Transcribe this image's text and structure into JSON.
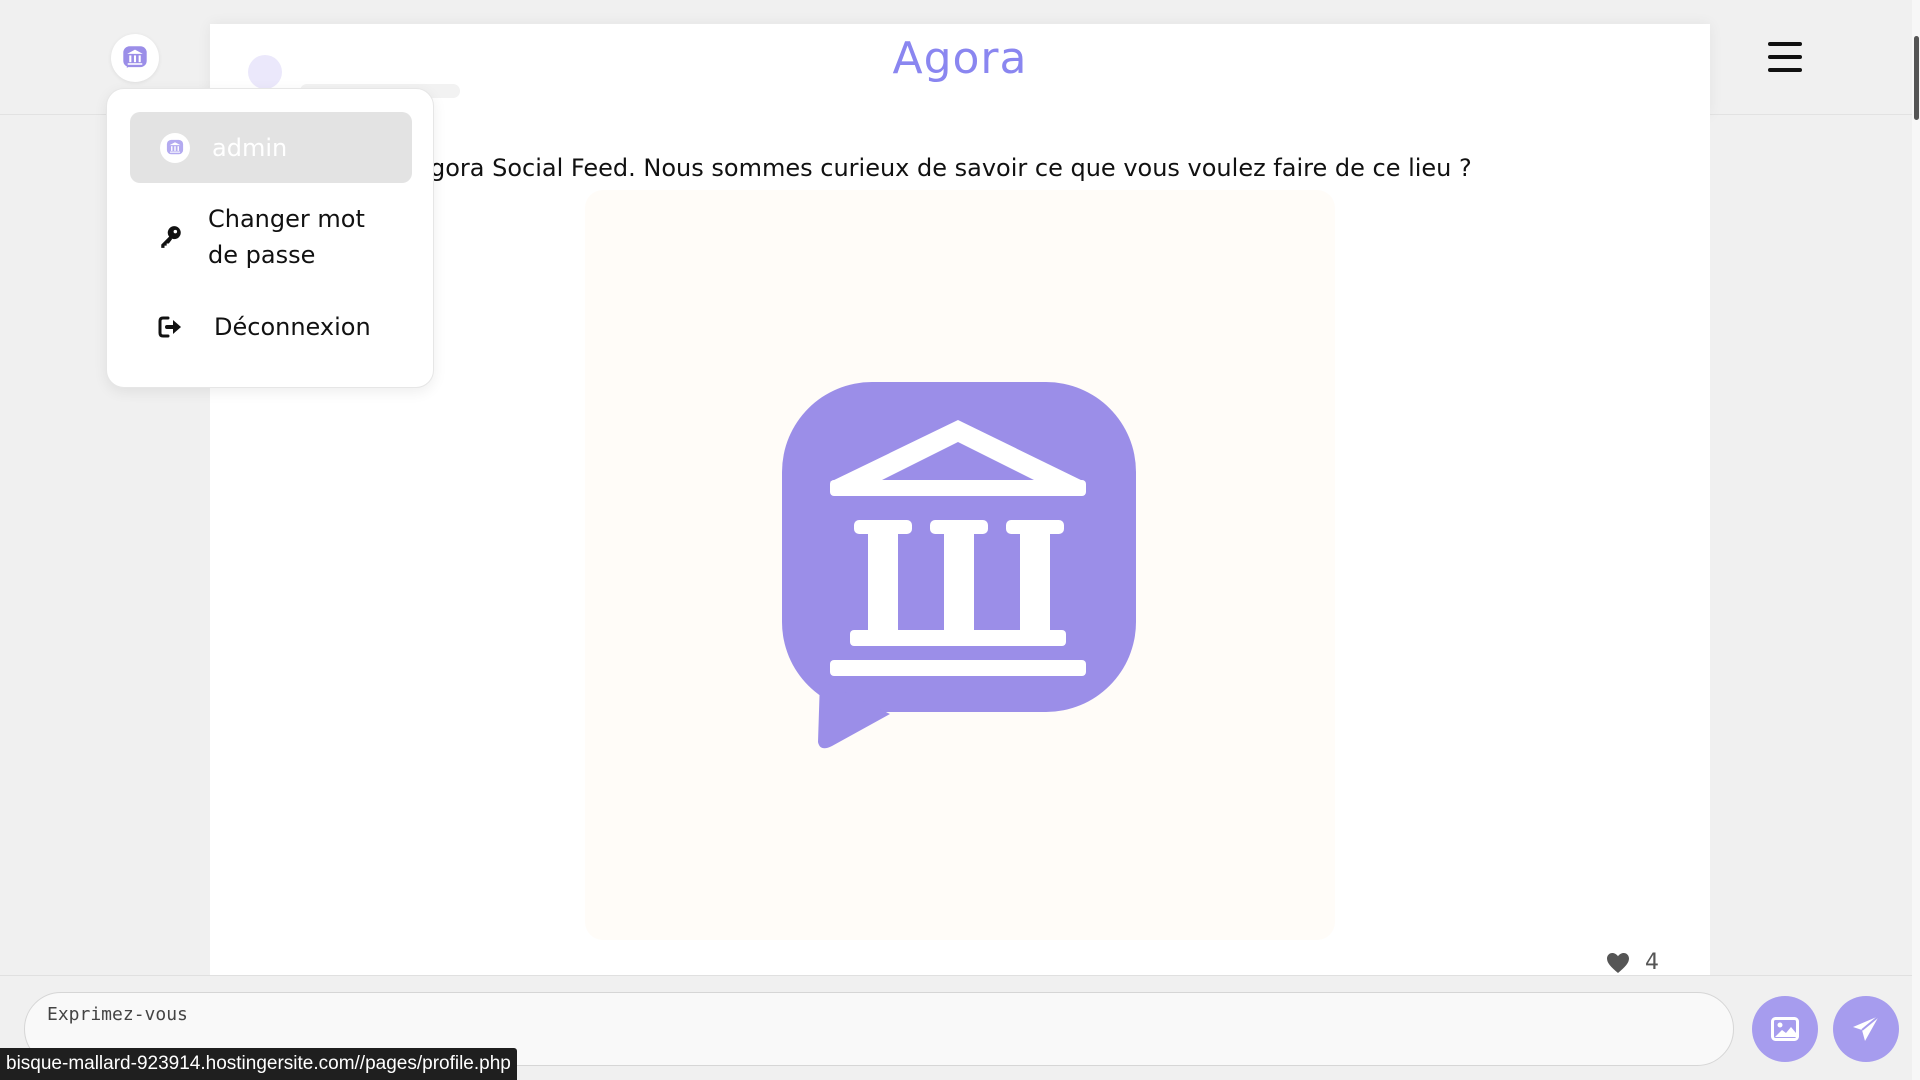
{
  "header": {
    "title": "Agora",
    "avatar_icon": "agora-logo-icon",
    "menu_icon": "hamburger-icon"
  },
  "post": {
    "text": "gora Social Feed. Nous sommes curieux de savoir ce que vous voulez faire de ce lieu ?",
    "image_icon": "agora-building-chat-icon",
    "likes": "4"
  },
  "menu": {
    "user_label": "admin",
    "items": [
      {
        "label": "Changer mot de passe",
        "icon": "key-icon"
      },
      {
        "label": "Déconnexion",
        "icon": "logout-icon"
      }
    ]
  },
  "composer": {
    "placeholder": "Exprimez-vous",
    "image_button_icon": "image-icon",
    "send_button_icon": "send-icon"
  },
  "status_url": "bisque-mallard-923914.hostingersite.com//pages/profile.php",
  "colors": {
    "brand": "#8a86f0",
    "logo_purple": "#9b8ee8",
    "button_purple": "#a69cee"
  }
}
